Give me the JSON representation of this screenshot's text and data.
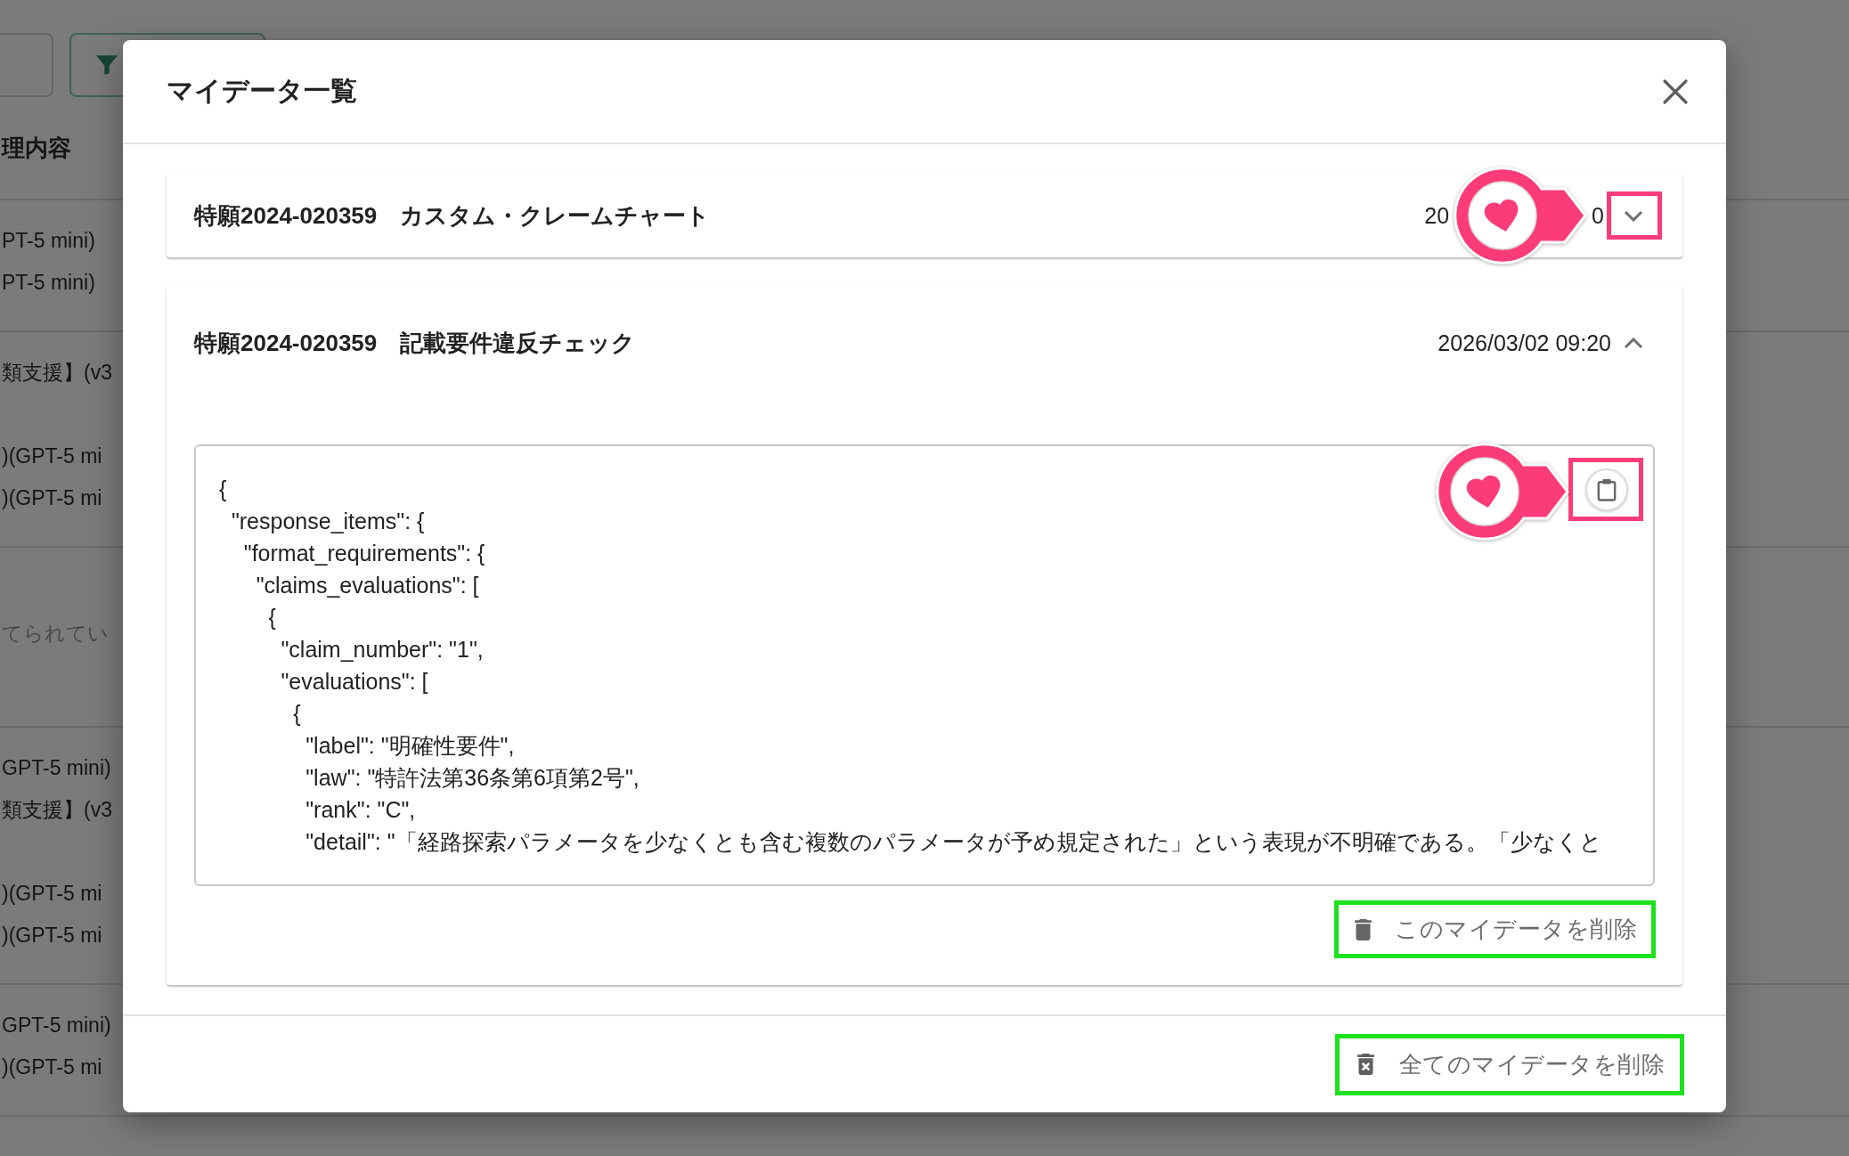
{
  "background_table": {
    "header": "理内容",
    "rows": [
      {
        "kind": "entries",
        "blocks": [
          [
            "PT-5 mini)",
            "PT-5 mini)"
          ]
        ]
      },
      {
        "kind": "entries",
        "blocks": [
          [
            "類支援】(v3"
          ],
          [
            ")(GPT-5 mi",
            ")(GPT-5 mi"
          ]
        ]
      },
      {
        "kind": "note",
        "blocks": [
          [
            "てられてい"
          ]
        ]
      },
      {
        "kind": "entries",
        "blocks": [
          [
            "GPT-5 mini)",
            "類支援】(v3"
          ],
          [
            ")(GPT-5 mi",
            ")(GPT-5 mi"
          ]
        ]
      },
      {
        "kind": "entries",
        "blocks": [
          [
            "GPT-5 mini)",
            ")(GPT-5 mi"
          ]
        ]
      }
    ]
  },
  "dialog": {
    "title": "マイデータ一覧",
    "items": [
      {
        "title": "特願2024-020359　カスタム・クレームチャート",
        "date_fragments": [
          "20",
          "0"
        ],
        "expanded": false,
        "toggle_highlighted": true
      },
      {
        "title": "特願2024-020359　記載要件違反チェック",
        "date": "2026/03/02 09:20",
        "expanded": true,
        "toggle_highlighted": false,
        "content_lines": [
          "{",
          "  \"response_items\": {",
          "    \"format_requirements\": {",
          "      \"claims_evaluations\": [",
          "        {",
          "          \"claim_number\": \"1\",",
          "          \"evaluations\": [",
          "            {",
          "              \"label\": \"明確性要件\",",
          "              \"law\": \"特許法第36条第6項第2号\",",
          "              \"rank\": \"C\",",
          "              \"detail\": \"「経路探索パラメータを少なくとも含む複数のパラメータが予め規定された」という表現が不明確である。「少なくと"
        ],
        "copy_highlighted": true,
        "delete_button": {
          "label": "このマイデータを削除",
          "highlighted": true
        }
      }
    ],
    "delete_all_button": {
      "label": "全てのマイデータを削除",
      "highlighted": true
    }
  }
}
